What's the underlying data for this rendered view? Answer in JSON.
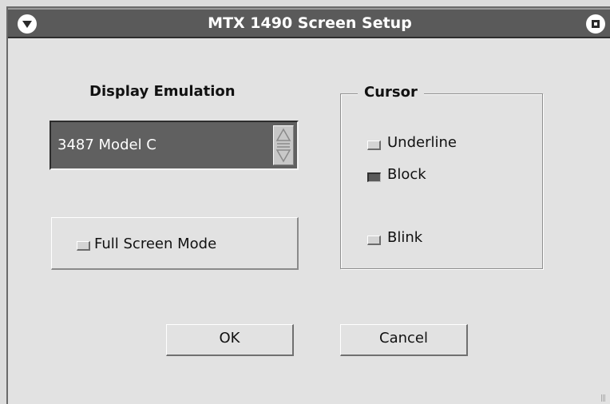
{
  "window": {
    "title": "MTX 1490 Screen Setup",
    "menu_icon": "down-triangle-icon",
    "maximize_icon": "square-icon"
  },
  "display_emulation": {
    "label": "Display Emulation",
    "selected_value": "3487 Model C",
    "spinner_icon": "up-down-arrows-icon"
  },
  "full_screen": {
    "label": "Full Screen Mode",
    "checked": false
  },
  "cursor": {
    "legend": "Cursor",
    "options": [
      {
        "label": "Underline",
        "checked": false
      },
      {
        "label": "Block",
        "checked": true
      },
      {
        "label": "Blink",
        "checked": false
      }
    ]
  },
  "buttons": {
    "ok": "OK",
    "cancel": "Cancel"
  },
  "colors": {
    "titlebar": "#5a5a5a",
    "dialog_bg": "#e2e2e2",
    "combo_bg": "#606060"
  }
}
